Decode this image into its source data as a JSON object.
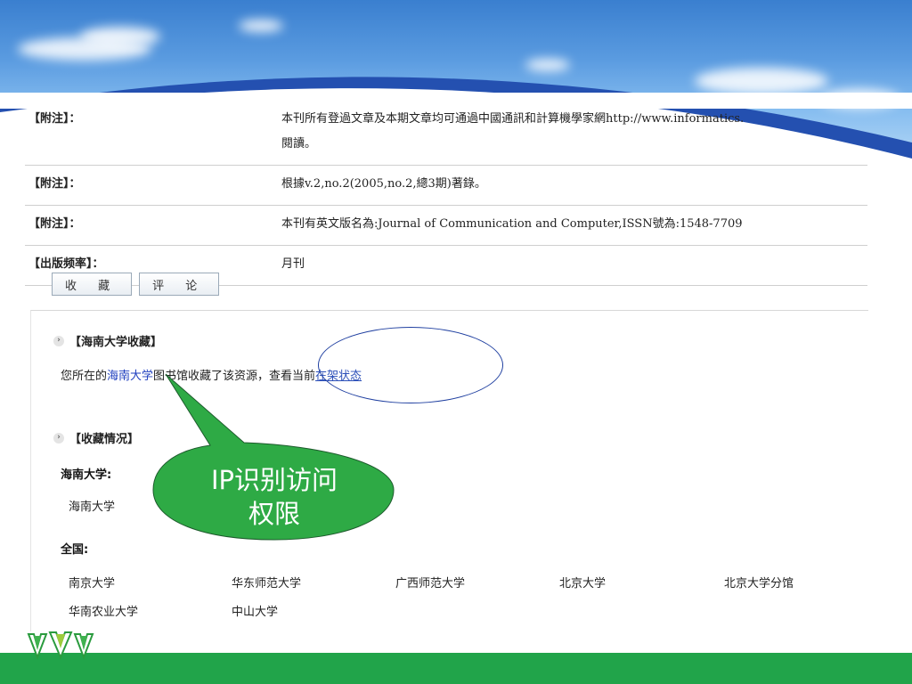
{
  "info_rows": [
    {
      "label": "【附注】：",
      "value_line1": "本刊所有登過文章及本期文章均可通過中國通訊和計算機學家網http://www.informatics.",
      "value_line2": "閱讀。"
    },
    {
      "label": "【附注】：",
      "value_line1": "根據v.2,no.2(2005,no.2,總3期)著錄。"
    },
    {
      "label": "【附注】：",
      "value_line1": "本刊有英文版名為:Journal of Communication and Computer,ISSN號為:1548-7709"
    },
    {
      "label": "【出版频率】：",
      "value_line1": "月刊"
    }
  ],
  "buttons": {
    "collect": "收 藏",
    "comment": "评 论"
  },
  "hainan_section": {
    "title": "【海南大学收藏】",
    "line_prefix": "您所在的",
    "library_link": "海南大学",
    "line_middle": "图书馆收藏了该资源，查看当前",
    "status_link": "在架状态"
  },
  "holdings_section": {
    "title": "【收藏情况】",
    "local_heading": "海南大学:",
    "local_library": "海南大学",
    "national_heading": "全国:",
    "national_libraries": [
      "南京大学",
      "华东师范大学",
      "广西师范大学",
      "北京大学",
      "北京大学分馆",
      "华南农业大学",
      "中山大学"
    ]
  },
  "callout": {
    "line1": "IP识别访问",
    "line2": "权限"
  },
  "colors": {
    "bottom_bar": "#21a44a",
    "callout_fill": "#2eaa45",
    "link": "#1f3fbf"
  }
}
